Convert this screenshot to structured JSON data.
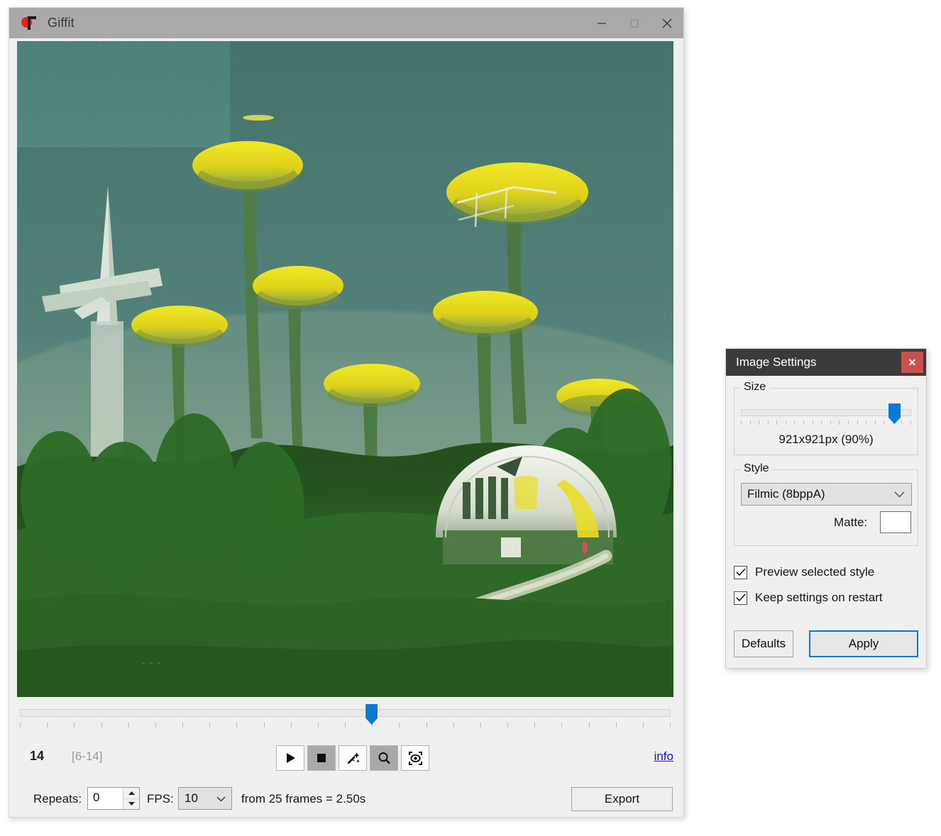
{
  "app": {
    "title": "Giffit",
    "icon": "app-logo-icon",
    "window_controls": {
      "minimize": "minimize-icon",
      "maximize": "maximize-icon",
      "close": "close-icon"
    }
  },
  "preview": {
    "description": "Dithered retro-futuristic illustration: yellow mushroom-shaped floating structures over a teal sky above a dense green forest with a white dome house and winding path",
    "sky_color": "#47786f",
    "accent_color": "#e8e21d",
    "forest_color": "#2e6b28"
  },
  "timeline": {
    "current_frame": "14",
    "frame_range": "[6-14]",
    "total_ticks": 25,
    "thumb_percent": 54,
    "handle_color": "#0a7ad1"
  },
  "toolbar": {
    "buttons": [
      {
        "name": "play-button",
        "icon": "play-icon",
        "active": false
      },
      {
        "name": "stop-button",
        "icon": "stop-icon",
        "active": true
      },
      {
        "name": "magic-wand-button",
        "icon": "magic-wand-icon",
        "active": false
      },
      {
        "name": "zoom-button",
        "icon": "magnifier-icon",
        "active": true
      },
      {
        "name": "focus-button",
        "icon": "focus-target-icon",
        "active": false
      }
    ],
    "info_link": "info"
  },
  "export_bar": {
    "repeats_label": "Repeats:",
    "repeats_value": "0",
    "fps_label": "FPS:",
    "fps_value": "10",
    "summary": "from 25 frames = 2.50s",
    "export_label": "Export"
  },
  "settings_dialog": {
    "title": "Image Settings",
    "close_label": "✕",
    "close_color": "#c8504e",
    "size": {
      "group_label": "Size",
      "readout": "921x921px (90%)",
      "slider_percent": 90,
      "ticks": 20
    },
    "style": {
      "group_label": "Style",
      "selected": "Filmic (8bppA)",
      "matte_label": "Matte:",
      "matte_color": "#ffffff"
    },
    "checkboxes": [
      {
        "label": "Preview selected style",
        "checked": true
      },
      {
        "label": "Keep settings on restart",
        "checked": true
      }
    ],
    "buttons": {
      "defaults": "Defaults",
      "apply": "Apply",
      "apply_focus_color": "#0a7ad1"
    }
  }
}
